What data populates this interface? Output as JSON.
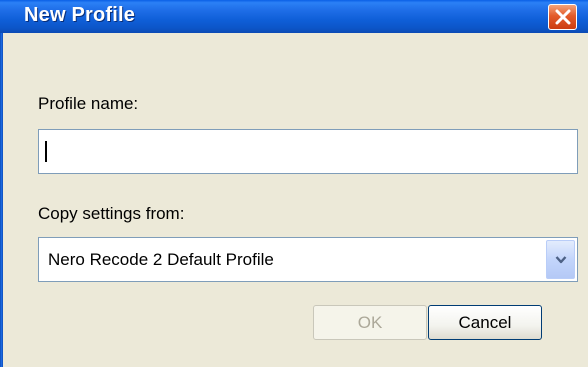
{
  "window": {
    "title": "New Profile",
    "close_icon": "close-icon"
  },
  "form": {
    "profile_name_label": "Profile name:",
    "profile_name_value": "",
    "copy_settings_label": "Copy settings from:",
    "copy_settings_value": "Nero Recode 2 Default Profile",
    "dropdown_icon": "chevron-down-icon"
  },
  "buttons": {
    "ok_label": "OK",
    "ok_enabled": false,
    "cancel_label": "Cancel"
  },
  "colors": {
    "titlebar": "#0f5fd8",
    "client_bg": "#ece9d8",
    "close_button": "#e35b2a",
    "input_border": "#7f9db9"
  }
}
